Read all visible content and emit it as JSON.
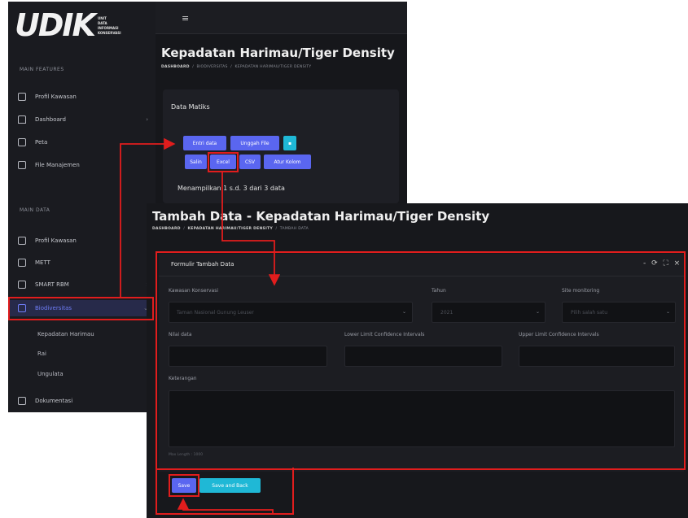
{
  "colors": {
    "annotation": "#e11d1d",
    "primary": "#5a66f0",
    "info": "#1fb8d6",
    "active_nav": "#6f7df7"
  },
  "logo": {
    "text": "UDIK",
    "sub": [
      "UNIT",
      "DATA",
      "INFORMASI",
      "KONSERVASI"
    ]
  },
  "sidebar": {
    "section_main": "MAIN FEATURES",
    "section_data": "MAIN DATA",
    "main_items": [
      {
        "label": "Profil Kawasan",
        "icon": "grid-icon"
      },
      {
        "label": "Dashboard",
        "icon": "home-icon",
        "has_chevron": true
      },
      {
        "label": "Peta",
        "icon": "map-icon"
      },
      {
        "label": "File Manajemen",
        "icon": "folder-icon"
      }
    ],
    "data_items": [
      {
        "label": "Profil Kawasan",
        "icon": "grid-icon"
      },
      {
        "label": "METT",
        "icon": "grid-icon"
      },
      {
        "label": "SMART RBM",
        "icon": "grid-icon",
        "has_chevron": true
      },
      {
        "label": "Biodiversitas",
        "icon": "grid-icon",
        "has_chevron": true,
        "active": true
      }
    ],
    "sub_items": [
      "Kepadatan Harimau",
      "Rai",
      "Ungulata"
    ],
    "last_item": {
      "label": "Dokumentasi",
      "icon": "grid-icon"
    }
  },
  "topbar": {
    "menu_icon": "≡"
  },
  "list_page": {
    "title": "Kepadatan Harimau/Tiger Density",
    "breadcrumb": [
      "DASHBOARD",
      "BIODIVERSITAS",
      "KEPADATAN HARIMAU/TIGER DENSITY"
    ],
    "card_title": "Data Matiks",
    "buttons_row1": [
      "Entri data",
      "Unggah File"
    ],
    "buttons_row2": [
      "Salin",
      "Excel",
      "CSV",
      "Atur Kolom"
    ],
    "showing_text": "Menampilkan 1 s.d. 3 dari 3 data"
  },
  "form_page": {
    "title": "Tambah Data - Kepadatan Harimau/Tiger Density",
    "breadcrumb": [
      "DASHBOARD",
      "KEPADATAN HARIMAU/TIGER DENSITY",
      "TAMBAH DATA"
    ],
    "form_title": "Formulir Tambah Data",
    "tools": "- ⟳ ⛶ ×",
    "fields": {
      "kawasan_label": "Kawasan Konservasi",
      "kawasan_value": "Taman Nasional Gunung Leuser",
      "tahun_label": "Tahun",
      "tahun_value": "2021",
      "site_label": "Site monitoring",
      "site_placeholder": "Pilih salah satu",
      "nilai_label": "Nilai data",
      "lower_label": "Lower Limit Confidence Intervals",
      "upper_label": "Upper Limit Confidence Intervals",
      "keterangan_label": "Keterangan",
      "keterangan_hint": "Max Length : 1000"
    },
    "buttons": [
      "Save",
      "Save and Back"
    ]
  }
}
